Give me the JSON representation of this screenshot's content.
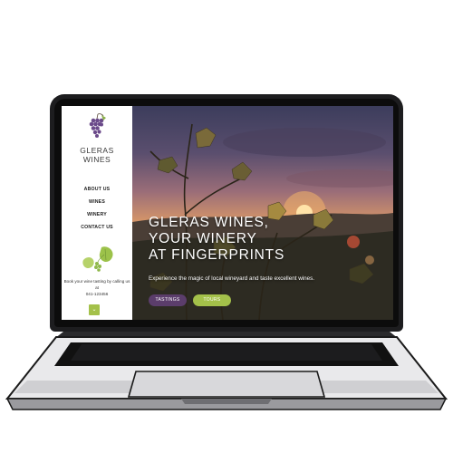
{
  "sidebar": {
    "brand_line1": "GLERAS",
    "brand_line2": "WINES",
    "nav": [
      {
        "label": "ABOUT US"
      },
      {
        "label": "WINES"
      },
      {
        "label": "WINERY"
      },
      {
        "label": "CONTACT US"
      }
    ],
    "cta_text": "Book your wine tasting by calling us at",
    "cta_phone": "041-123456",
    "small_button_icon": "chevron-down-icon"
  },
  "hero": {
    "headline_line1": "GLERAS WINES,",
    "headline_line2": "YOUR WINERY",
    "headline_line3": "AT FINGERPRINTS",
    "subline": "Experience the magic of local wineyard and taste excellent wines.",
    "buttons": [
      {
        "label": "TASTINGS",
        "color": "#5b3d6b"
      },
      {
        "label": "TOURS",
        "color": "#a4c14a"
      }
    ]
  },
  "colors": {
    "accent_purple": "#5b3d6b",
    "accent_green": "#a4c14a",
    "laptop_frame": "#1d1d1f"
  }
}
